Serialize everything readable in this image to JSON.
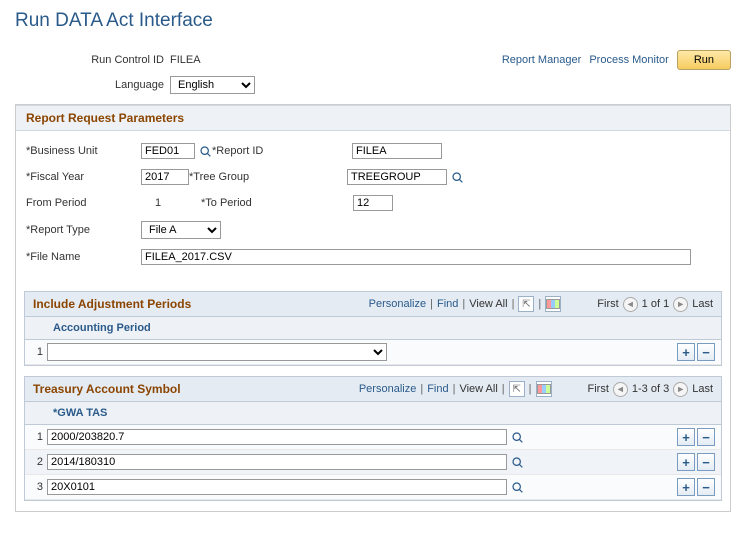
{
  "page_title": "Run DATA Act Interface",
  "header": {
    "run_control_label": "Run Control ID",
    "run_control_value": "FILEA",
    "language_label": "Language",
    "language_value": "English",
    "report_manager": "Report Manager",
    "process_monitor": "Process Monitor",
    "run_button": "Run"
  },
  "section1_title": "Report Request Parameters",
  "params": {
    "business_unit_label": "*Business Unit",
    "business_unit_value": "FED01",
    "report_id_label": "*Report ID",
    "report_id_value": "FILEA",
    "fiscal_year_label": "*Fiscal Year",
    "fiscal_year_value": "2017",
    "tree_group_label": "*Tree Group",
    "tree_group_value": "TREEGROUP",
    "from_period_label": "From Period",
    "from_period_value": "1",
    "to_period_label": "*To Period",
    "to_period_value": "12",
    "report_type_label": "*Report Type",
    "report_type_value": "File A",
    "file_name_label": "*File Name",
    "file_name_value": "FILEA_2017.CSV"
  },
  "grid_tools": {
    "personalize": "Personalize",
    "find": "Find",
    "view_all": "View All",
    "first": "First",
    "last": "Last"
  },
  "grid1": {
    "title": "Include Adjustment Periods",
    "range": "1 of 1",
    "col1": "Accounting Period",
    "rows": [
      {
        "num": "1",
        "value": ""
      }
    ]
  },
  "grid2": {
    "title": "Treasury Account Symbol",
    "range": "1-3 of 3",
    "col1": "*GWA TAS",
    "rows": [
      {
        "num": "1",
        "value": "2000/203820.7"
      },
      {
        "num": "2",
        "value": "2014/180310"
      },
      {
        "num": "3",
        "value": "20X0101"
      }
    ]
  }
}
